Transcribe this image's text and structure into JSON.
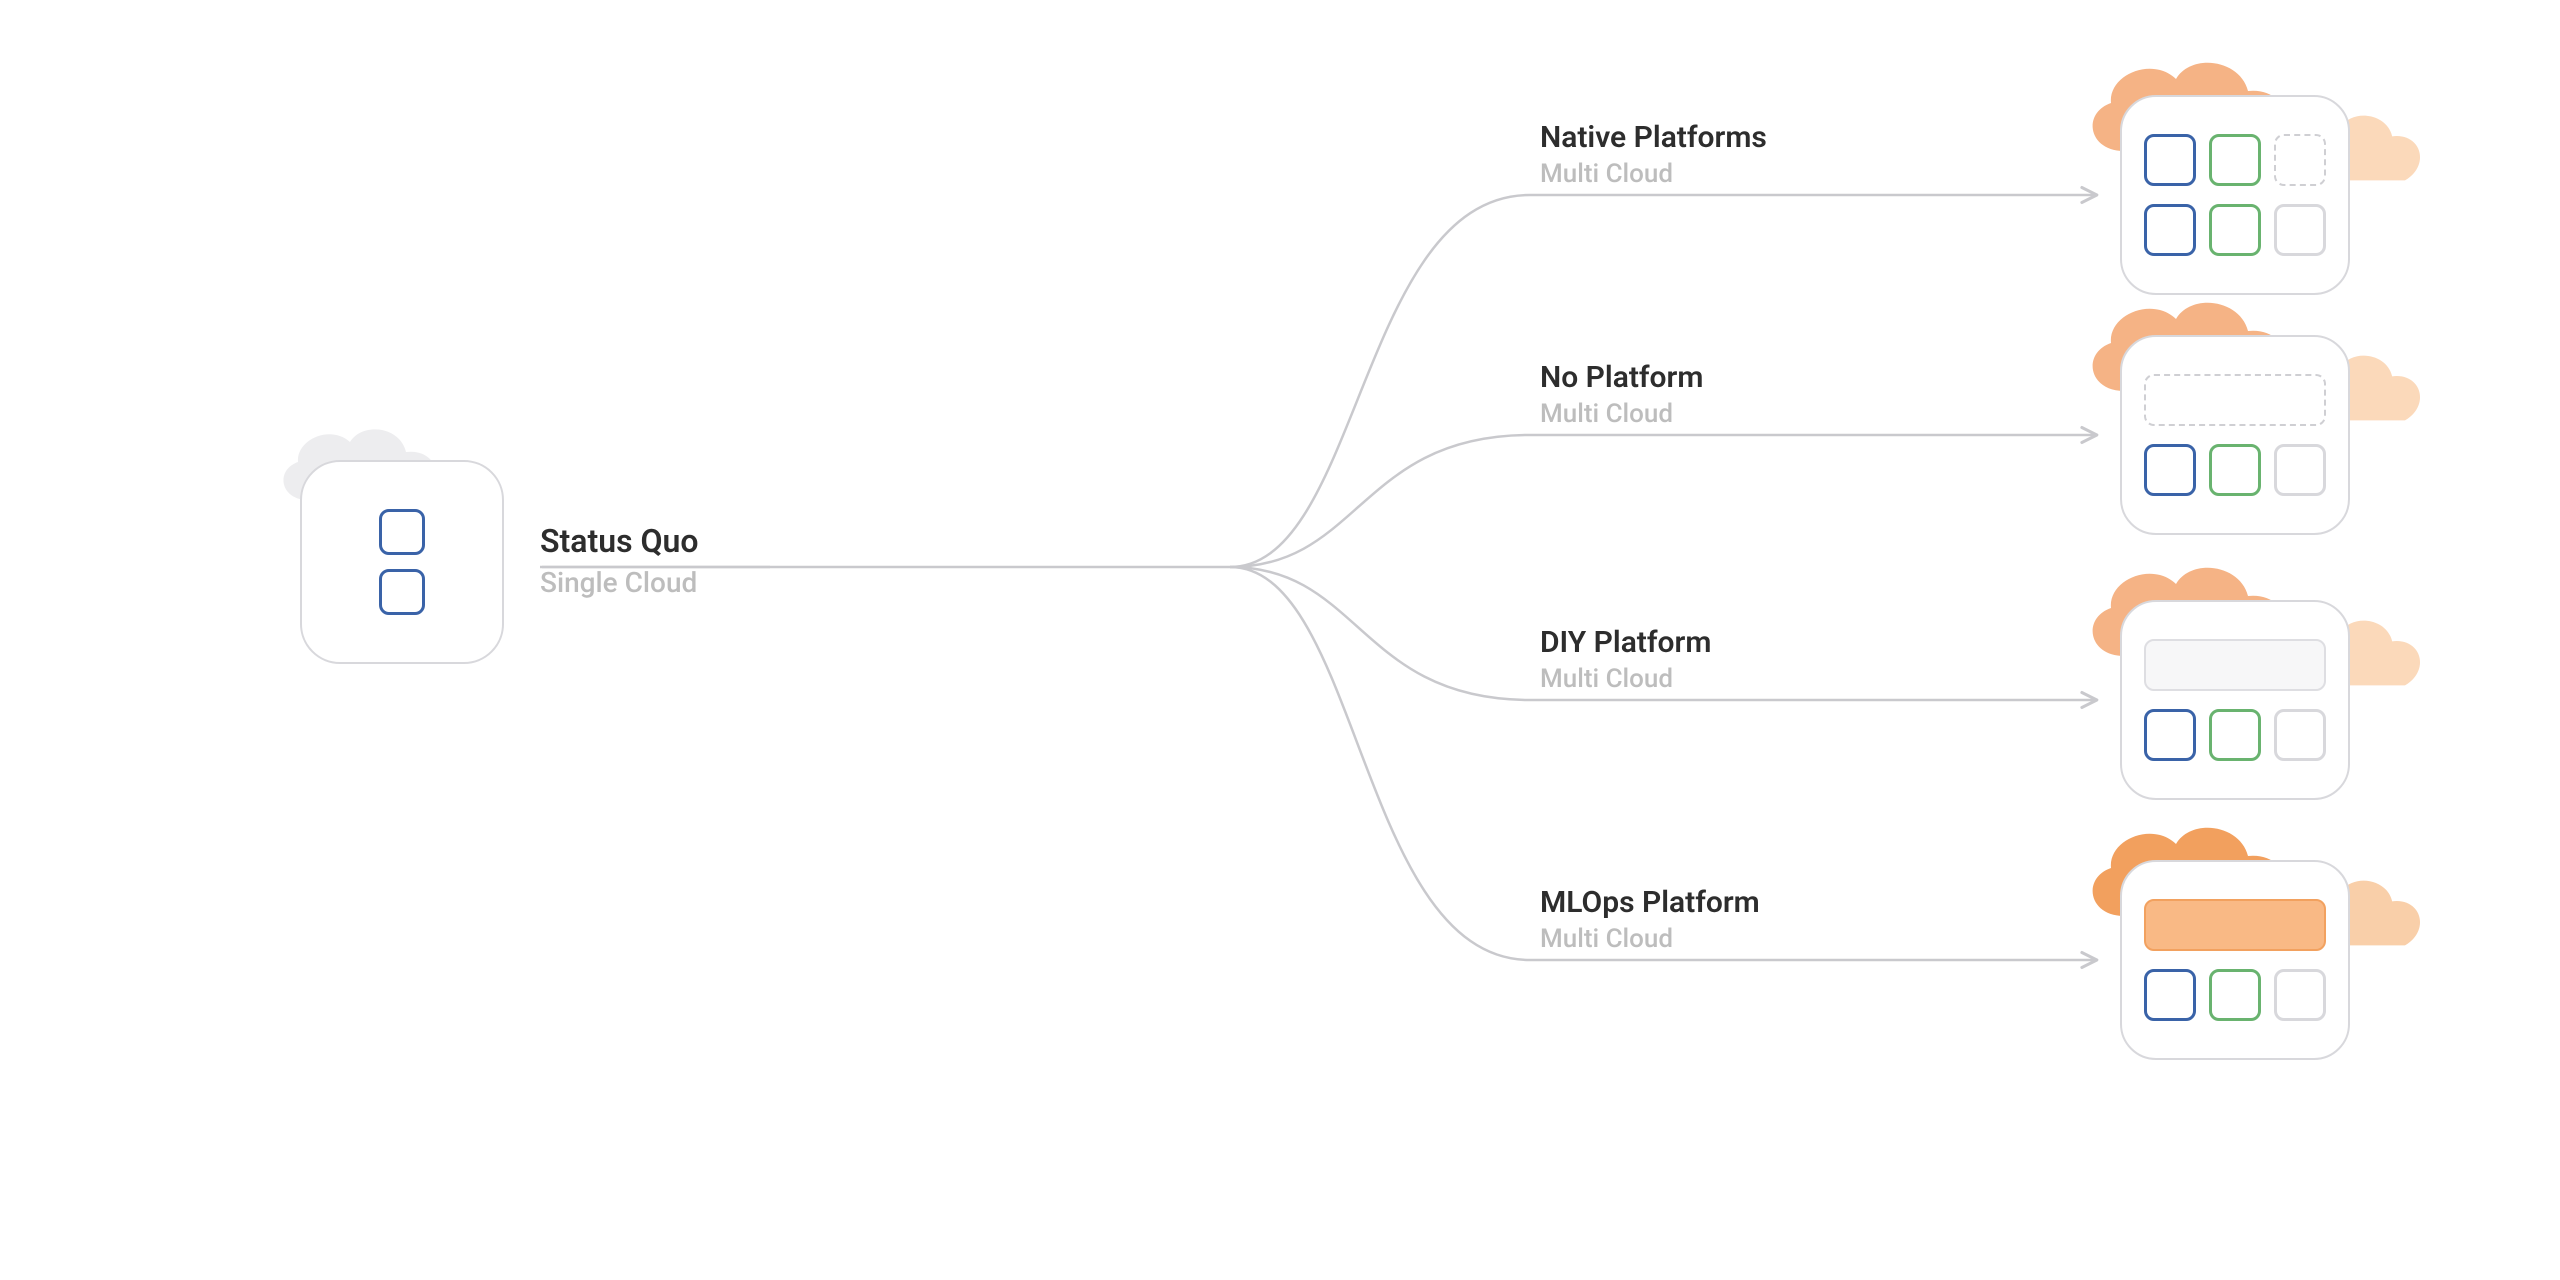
{
  "source": {
    "title": "Status Quo",
    "subtitle": "Single Cloud"
  },
  "branches": [
    {
      "title": "Native Platforms",
      "subtitle": "Multi Cloud"
    },
    {
      "title": "No Platform",
      "subtitle": "Multi Cloud"
    },
    {
      "title": "DIY Platform",
      "subtitle": "Multi Cloud"
    },
    {
      "title": "MLOps Platform",
      "subtitle": "Multi Cloud"
    }
  ]
}
